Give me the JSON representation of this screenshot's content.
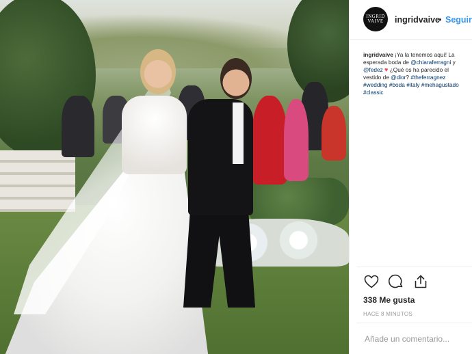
{
  "post": {
    "username": "ingridvaive",
    "avatar_text_line1": "INGRID",
    "avatar_text_line2": "VAIVE",
    "separator": "•",
    "follow_label": "Seguir",
    "caption": {
      "username": "ingridvaive",
      "part1": " ¡Ya la tenemos aquí! La esperada boda de ",
      "mention1": "@chiaraferragni",
      "part2": " y ",
      "mention2": "@fedez",
      "part3": " ",
      "heart": "♥",
      "part4": " ¿Qué os ha parecido el vestido de ",
      "mention3": "@dior",
      "part5": "? ",
      "hashtags": "#theferragnez #wedding #boda #italy #mehagustado #classic"
    },
    "likes_text": "338 Me gusta",
    "time_text": "HACE 8 MINUTOS",
    "comment_placeholder": "Añade un comentario..."
  },
  "icons": {
    "like": "heart-outline-icon",
    "comment": "speech-bubble-icon",
    "share": "share-upload-icon"
  },
  "colors": {
    "link": "#003569",
    "follow": "#3897f0",
    "heart": "#ed4956",
    "muted": "#999999"
  }
}
